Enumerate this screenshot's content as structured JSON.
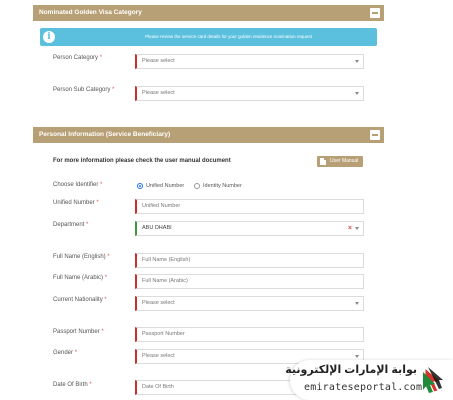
{
  "section1": {
    "title": "Nominated Golden Visa Category",
    "alert": "Please review the service card details for your golden residence nomination request",
    "person_category_label": "Person Category",
    "person_category_value": "Please select",
    "person_sub_category_label": "Person Sub Category",
    "person_sub_category_value": "Please select"
  },
  "section2": {
    "title": "Personal Information (Service Beneficiary)",
    "more_info": "For more information please check the user manual document",
    "user_manual_label": "User Manual",
    "choose_identifier_label": "Choose Identifier",
    "radio_unified": "Unified Number",
    "radio_identity": "Identity Number",
    "unified_number_label": "Unified Number",
    "unified_number_placeholder": "Unified Number",
    "department_label": "Department",
    "department_value": "ABU DHABI",
    "full_name_en_label": "Full Name (English)",
    "full_name_en_placeholder": "Full Name (English)",
    "full_name_ar_label": "Full Name (Arabic)",
    "full_name_ar_placeholder": "Full Name (Arabic)",
    "nationality_label": "Current Nationality",
    "nationality_value": "Please select",
    "passport_label": "Passport Number",
    "passport_placeholder": "Passport Number",
    "gender_label": "Gender",
    "gender_value": "Please select",
    "dob_label": "Date Of Birth",
    "dob_placeholder": "Date Of Birth"
  },
  "required_mark": "*",
  "watermark": {
    "arabic": "بوابة الإمارات الإلكترونية",
    "english": "emirateseportal.com"
  },
  "colors": {
    "header": "#b8a076",
    "alert": "#5bc0de",
    "required_border": "#c9302c",
    "valid_border": "#3c9a3c"
  }
}
